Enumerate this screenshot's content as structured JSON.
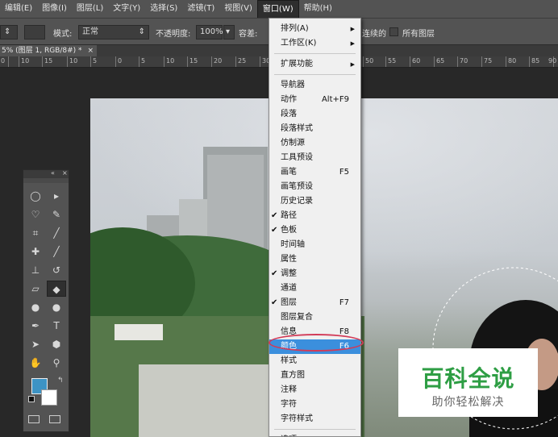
{
  "menubar": {
    "items": [
      "编辑(E)",
      "图像(I)",
      "图层(L)",
      "文字(Y)",
      "选择(S)",
      "滤镜(T)",
      "视图(V)",
      "窗口(W)",
      "帮助(H)"
    ]
  },
  "options": {
    "mode_label": "模式:",
    "mode_value": "正常",
    "opacity_label": "不透明度:",
    "opacity_value": "100%",
    "tolerance_label": "容差:",
    "contiguous_label": "连续的",
    "all_layers_label": "所有图层"
  },
  "doc_tab": {
    "title": "5% (图层 1, RGB/8#) *",
    "close": "×"
  },
  "ruler": {
    "labels": [
      "0",
      "10",
      "15",
      "10",
      "5",
      "0",
      "5",
      "10",
      "15",
      "20",
      "25",
      "30",
      "50",
      "55",
      "60",
      "65",
      "70",
      "75",
      "80",
      "85",
      "90"
    ]
  },
  "tools": {
    "header_collapse": "«",
    "header_close": "×",
    "icons": [
      "elliptical-marquee",
      "move",
      "lasso",
      "quick-selection",
      "crop",
      "eyedropper",
      "healing-brush",
      "brush",
      "clone-stamp",
      "history-brush",
      "eraser",
      "paint-bucket",
      "blur",
      "dodge",
      "pen",
      "type",
      "path-selection",
      "shape",
      "hand",
      "zoom"
    ],
    "fg_color": "#3d93c4",
    "bg_color": "#ffffff"
  },
  "window_menu": {
    "items": [
      {
        "label": "排列(A)",
        "shortcut": "",
        "sub": true,
        "checked": false
      },
      {
        "label": "工作区(K)",
        "shortcut": "",
        "sub": true,
        "checked": false
      },
      {
        "label": "扩展功能",
        "shortcut": "",
        "sub": true,
        "checked": false
      },
      {
        "label": "导航器",
        "shortcut": "",
        "sub": false,
        "checked": false
      },
      {
        "label": "动作",
        "shortcut": "Alt+F9",
        "sub": false,
        "checked": false
      },
      {
        "label": "段落",
        "shortcut": "",
        "sub": false,
        "checked": false
      },
      {
        "label": "段落样式",
        "shortcut": "",
        "sub": false,
        "checked": false
      },
      {
        "label": "仿制源",
        "shortcut": "",
        "sub": false,
        "checked": false
      },
      {
        "label": "工具预设",
        "shortcut": "",
        "sub": false,
        "checked": false
      },
      {
        "label": "画笔",
        "shortcut": "F5",
        "sub": false,
        "checked": false
      },
      {
        "label": "画笔预设",
        "shortcut": "",
        "sub": false,
        "checked": false
      },
      {
        "label": "历史记录",
        "shortcut": "",
        "sub": false,
        "checked": false
      },
      {
        "label": "路径",
        "shortcut": "",
        "sub": false,
        "checked": true
      },
      {
        "label": "色板",
        "shortcut": "",
        "sub": false,
        "checked": true
      },
      {
        "label": "时间轴",
        "shortcut": "",
        "sub": false,
        "checked": false
      },
      {
        "label": "属性",
        "shortcut": "",
        "sub": false,
        "checked": false
      },
      {
        "label": "调整",
        "shortcut": "",
        "sub": false,
        "checked": true
      },
      {
        "label": "通道",
        "shortcut": "",
        "sub": false,
        "checked": false
      },
      {
        "label": "图层",
        "shortcut": "F7",
        "sub": false,
        "checked": true
      },
      {
        "label": "图层复合",
        "shortcut": "",
        "sub": false,
        "checked": false
      },
      {
        "label": "信息",
        "shortcut": "F8",
        "sub": false,
        "checked": false
      },
      {
        "label": "颜色",
        "shortcut": "F6",
        "sub": false,
        "checked": false,
        "highlight": true
      },
      {
        "label": "样式",
        "shortcut": "",
        "sub": false,
        "checked": false
      },
      {
        "label": "直方图",
        "shortcut": "",
        "sub": false,
        "checked": false
      },
      {
        "label": "注释",
        "shortcut": "",
        "sub": false,
        "checked": false
      },
      {
        "label": "字符",
        "shortcut": "",
        "sub": false,
        "checked": false
      },
      {
        "label": "字符样式",
        "shortcut": "",
        "sub": false,
        "checked": false
      },
      {
        "label": "选项",
        "shortcut": "",
        "sub": false,
        "checked": true
      }
    ]
  },
  "watermark": {
    "title": "百科全说",
    "subtitle": "助你轻松解决"
  }
}
